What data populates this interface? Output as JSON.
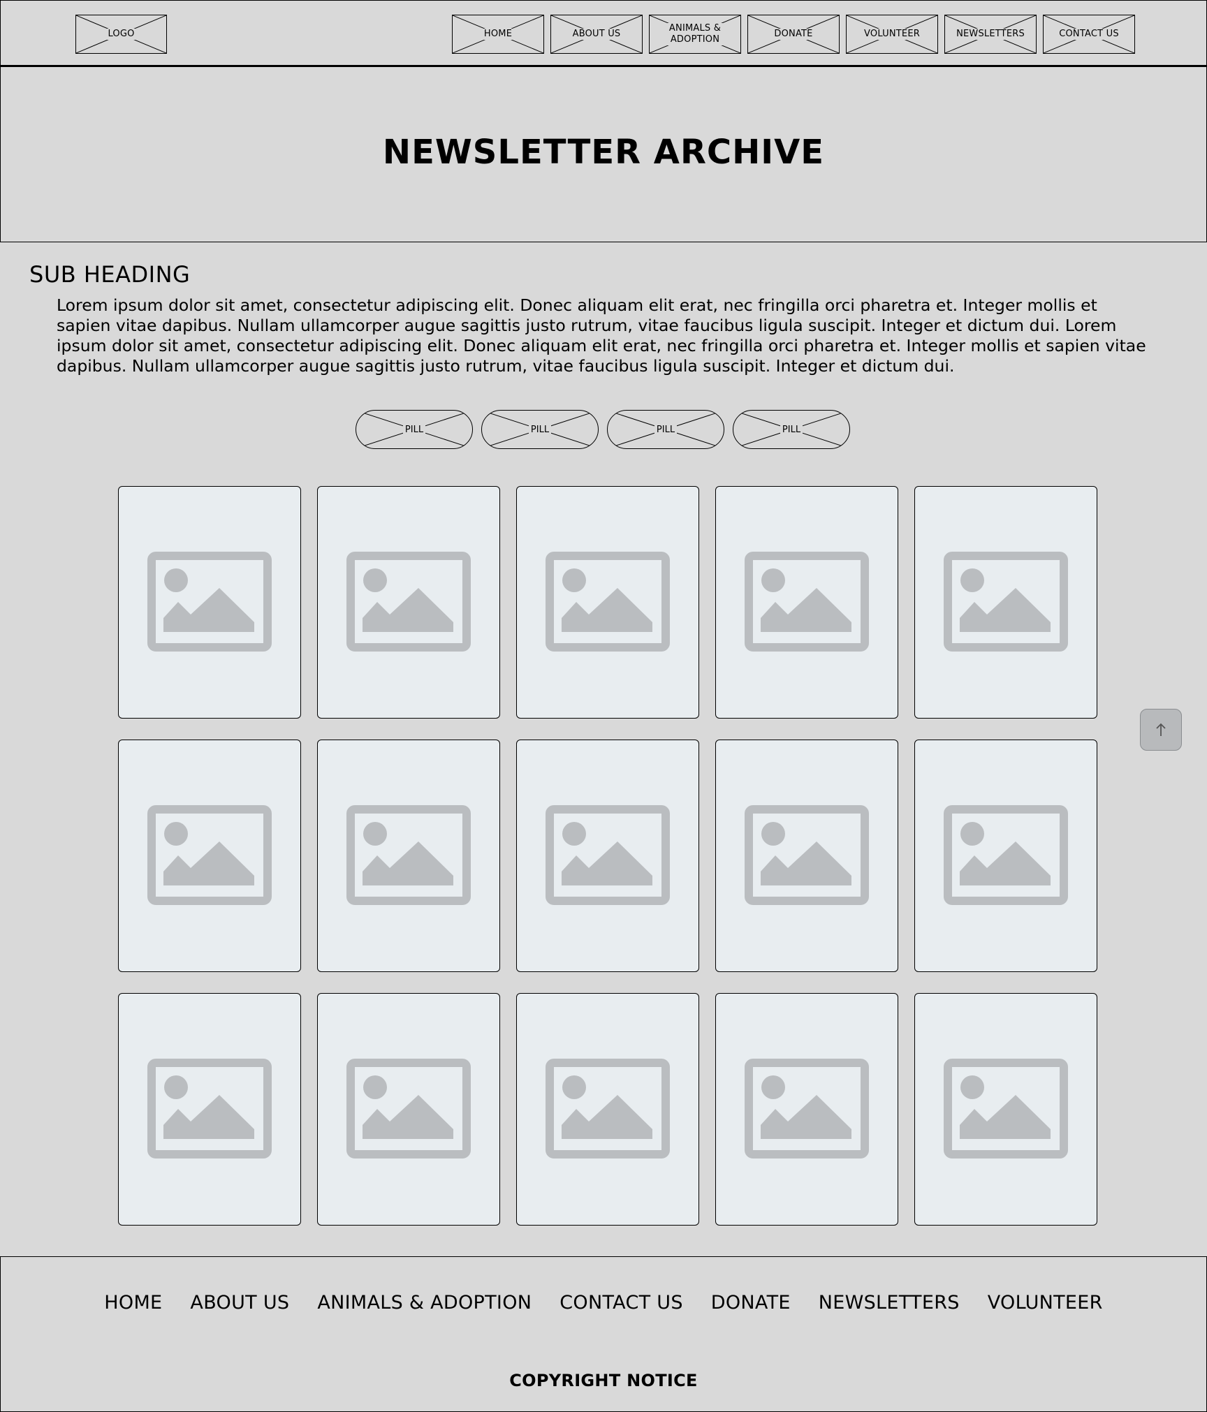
{
  "header": {
    "logo": "LOGO",
    "nav": [
      "HOME",
      "ABOUT US",
      "ANIMALS & ADOPTION",
      "DONATE",
      "VOLUNTEER",
      "NEWSLETTERS",
      "CONTACT US"
    ]
  },
  "hero": {
    "title": "NEWSLETTER ARCHIVE"
  },
  "intro": {
    "subheading": "SUB HEADING",
    "paragraph": "Lorem ipsum dolor sit amet, consectetur adipiscing elit. Donec aliquam elit erat, nec fringilla orci pharetra et. Integer mollis et sapien vitae dapibus. Nullam ullamcorper augue sagittis justo rutrum, vitae faucibus ligula suscipit. Integer et dictum dui. Lorem ipsum dolor sit amet, consectetur adipiscing elit. Donec aliquam elit erat, nec fringilla orci pharetra et. Integer mollis et sapien vitae dapibus. Nullam ullamcorper augue sagittis justo rutrum, vitae faucibus ligula suscipit. Integer et dictum dui."
  },
  "pills": [
    "PILL",
    "PILL",
    "PILL",
    "PILL"
  ],
  "grid": {
    "card_icon": "image-placeholder-icon"
  },
  "back_to_top": {
    "icon": "arrow-up-icon"
  },
  "footer": {
    "nav": [
      "HOME",
      "ABOUT US",
      "ANIMALS & ADOPTION",
      "CONTACT US",
      "DONATE",
      "NEWSLETTERS",
      "VOLUNTEER"
    ],
    "copyright": "COPYRIGHT NOTICE"
  },
  "colors": {
    "background": "#d9d9d9",
    "card_background": "#e8edf0",
    "placeholder_icon": "#babdc0"
  }
}
